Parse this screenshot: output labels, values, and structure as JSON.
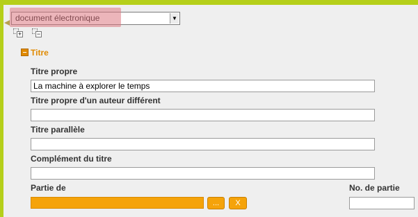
{
  "type_select": {
    "selected": "document électronique"
  },
  "tree": {
    "expand_label": "+",
    "collapse_label": "−"
  },
  "section": {
    "title": "Titre"
  },
  "fields": {
    "titre_propre": {
      "label": "Titre propre",
      "value": "La machine à explorer le temps"
    },
    "titre_auteur_different": {
      "label": "Titre propre d'un auteur différent",
      "value": ""
    },
    "titre_parallele": {
      "label": "Titre parallèle",
      "value": ""
    },
    "complement_titre": {
      "label": "Complément du titre",
      "value": ""
    },
    "partie_de": {
      "label": "Partie de",
      "value": "",
      "browse_label": "...",
      "clear_label": "X"
    },
    "no_partie": {
      "label": "No. de partie",
      "value": ""
    }
  },
  "colors": {
    "frame": "#b5cf1a",
    "accent": "#e08a00",
    "field_orange": "#f5a30a"
  }
}
